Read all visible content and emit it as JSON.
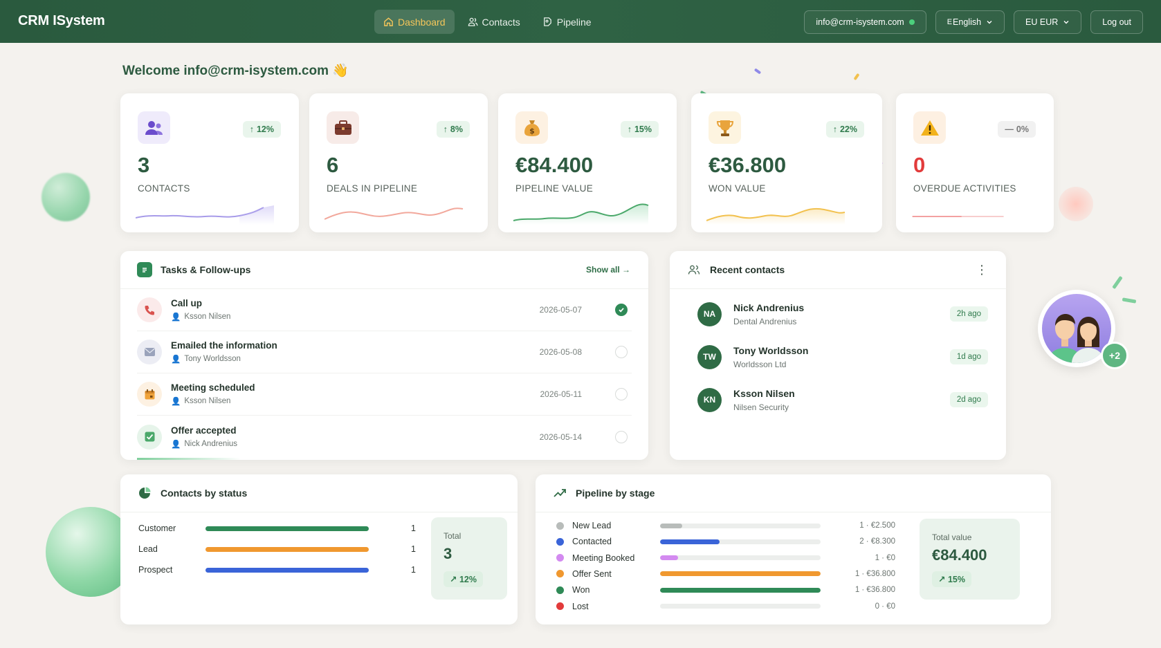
{
  "app": {
    "brand": "CRM ISystem"
  },
  "nav": [
    {
      "label": "Dashboard",
      "icon": "home-icon",
      "active": true
    },
    {
      "label": "Contacts",
      "icon": "users-icon",
      "active": false
    },
    {
      "label": "Pipeline",
      "icon": "pipeline-icon",
      "active": false
    }
  ],
  "topbar": {
    "account": "info@crm-isystem.com",
    "language": "English",
    "language_prefix": "E",
    "currency": "EU EUR",
    "logout": "Log out"
  },
  "welcome": {
    "text": "Welcome info@crm-isystem.com",
    "emoji": "👋"
  },
  "stats": [
    {
      "value": "3",
      "label": "CONTACTS",
      "trend": "12%",
      "trend_dir": "up",
      "icon": "users-icon",
      "color": "#8b7ee8"
    },
    {
      "value": "6",
      "label": "DEALS IN PIPELINE",
      "trend": "8%",
      "trend_dir": "up",
      "icon": "briefcase-icon",
      "color": "#f0a69a"
    },
    {
      "value": "€84.400",
      "label": "PIPELINE VALUE",
      "trend": "15%",
      "trend_dir": "up",
      "icon": "money-bag-icon",
      "color": "#5fb67a"
    },
    {
      "value": "€36.800",
      "label": "WON VALUE",
      "trend": "22%",
      "trend_dir": "up",
      "icon": "trophy-icon",
      "color": "#f2c75c"
    },
    {
      "value": "0",
      "label": "OVERDUE ACTIVITIES",
      "trend": "0%",
      "trend_dir": "flat",
      "icon": "warning-icon",
      "color": "#f08b8b"
    }
  ],
  "tasks": {
    "title": "Tasks & Follow-ups",
    "show_all": "Show all →",
    "items": [
      {
        "title": "Call up",
        "person": "Ksson Nilsen",
        "date": "2026-05-07",
        "done": true,
        "icon": "phone-icon"
      },
      {
        "title": "Emailed the information",
        "person": "Tony Worldsson",
        "date": "2026-05-08",
        "done": false,
        "icon": "mail-icon"
      },
      {
        "title": "Meeting scheduled",
        "person": "Ksson Nilsen",
        "date": "2026-05-11",
        "done": false,
        "icon": "calendar-icon"
      },
      {
        "title": "Offer accepted",
        "person": "Nick Andrenius",
        "date": "2026-05-14",
        "done": false,
        "icon": "check-square-icon"
      }
    ]
  },
  "recent_contacts": {
    "title": "Recent contacts",
    "items": [
      {
        "initials": "NA",
        "name": "Nick Andrenius",
        "company": "Dental Andrenius",
        "ago": "2h ago"
      },
      {
        "initials": "TW",
        "name": "Tony Worldsson",
        "company": "Worldsson Ltd",
        "ago": "1d ago"
      },
      {
        "initials": "KN",
        "name": "Ksson Nilsen",
        "company": "Nilsen Security",
        "ago": "2d ago"
      }
    ]
  },
  "team": {
    "more": "+2"
  },
  "contacts_by_status": {
    "title": "Contacts by status",
    "rows": [
      {
        "label": "Customer",
        "count": "1",
        "color": "#2f8a57"
      },
      {
        "label": "Lead",
        "count": "1",
        "color": "#f0982f"
      },
      {
        "label": "Prospect",
        "count": "1",
        "color": "#3a64d8"
      }
    ],
    "total_label": "Total",
    "total_value": "3",
    "total_trend": "12%"
  },
  "pipeline_by_stage": {
    "title": "Pipeline by stage",
    "rows": [
      {
        "label": "New Lead",
        "value": "1 · €2.500",
        "fill": 0.14,
        "color": "#b8bcba"
      },
      {
        "label": "Contacted",
        "value": "2 · €8.300",
        "fill": 0.37,
        "color": "#3a64d8"
      },
      {
        "label": "Meeting Booked",
        "value": "1 · €0",
        "fill": 0.11,
        "color": "#d38af0"
      },
      {
        "label": "Offer Sent",
        "value": "1 · €36.800",
        "fill": 1.0,
        "color": "#f0982f"
      },
      {
        "label": "Won",
        "value": "1 · €36.800",
        "fill": 1.0,
        "color": "#2f8a57"
      },
      {
        "label": "Lost",
        "value": "0 · €0",
        "fill": 0.0,
        "color": "#e23b3b"
      }
    ],
    "total_label": "Total value",
    "total_value": "€84.400",
    "total_trend": "15%"
  }
}
